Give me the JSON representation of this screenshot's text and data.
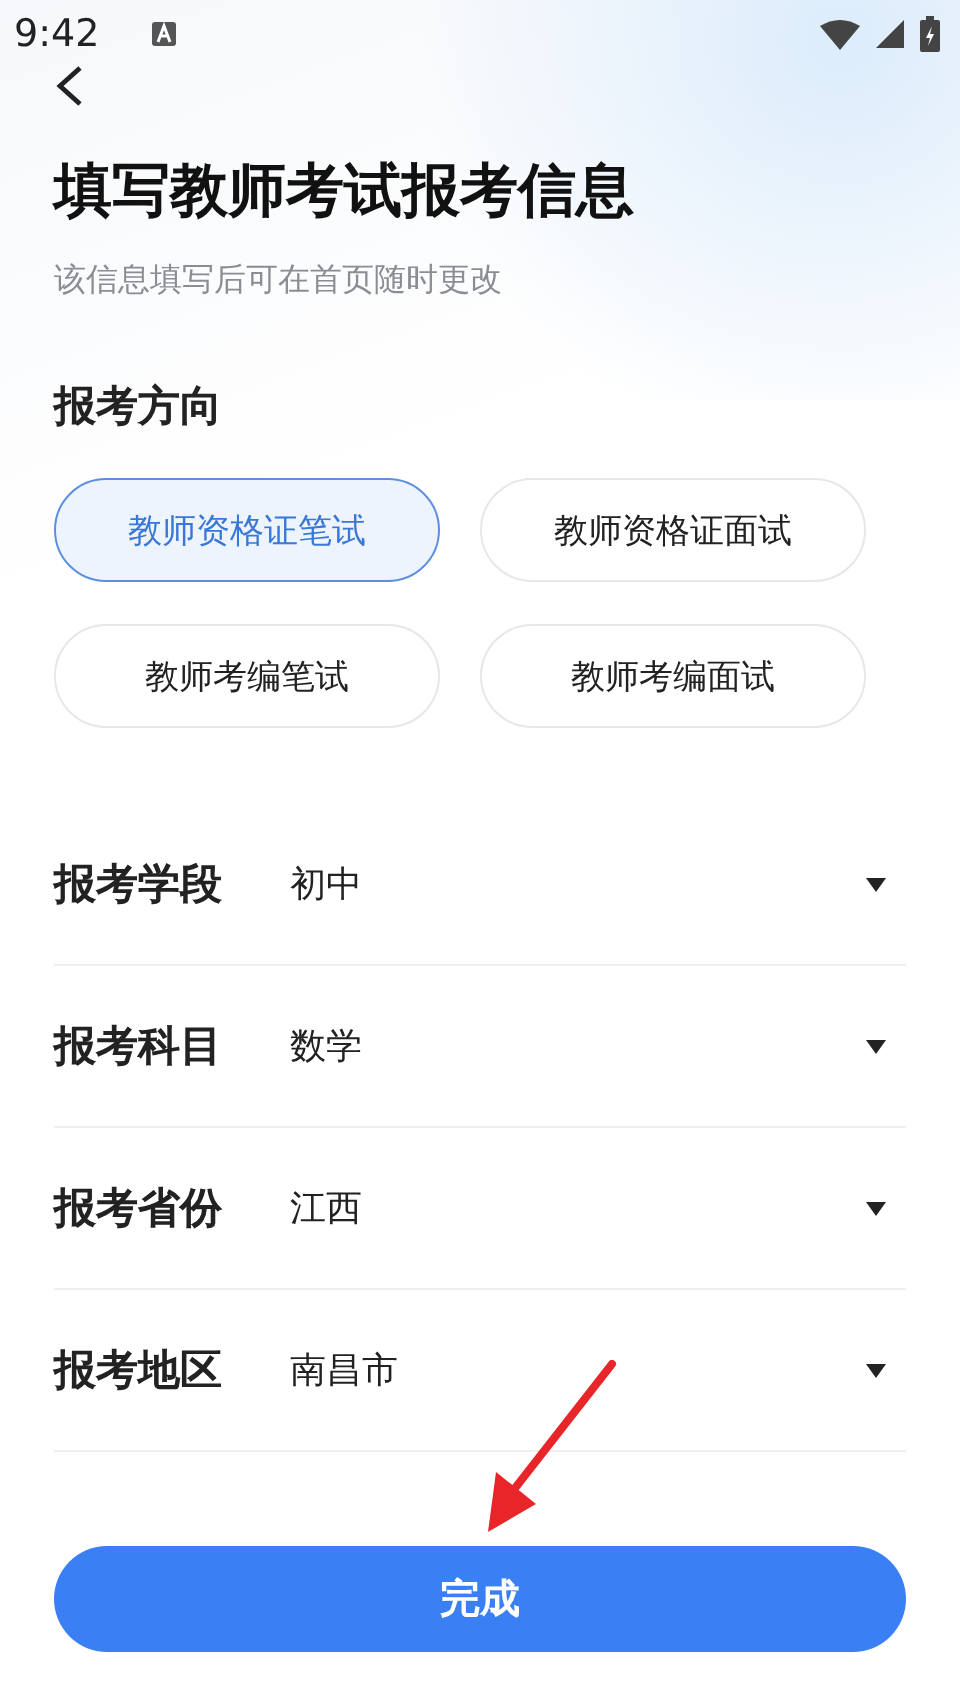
{
  "status_bar": {
    "time": "9:42"
  },
  "title": "填写教师考试报考信息",
  "subtitle": "该信息填写后可在首页随时更改",
  "direction": {
    "heading": "报考方向",
    "options": [
      {
        "label": "教师资格证笔试",
        "selected": true
      },
      {
        "label": "教师资格证面试",
        "selected": false
      },
      {
        "label": "教师考编笔试",
        "selected": false
      },
      {
        "label": "教师考编面试",
        "selected": false
      }
    ]
  },
  "fields": [
    {
      "label": "报考学段",
      "value": "初中"
    },
    {
      "label": "报考科目",
      "value": "数学"
    },
    {
      "label": "报考省份",
      "value": "江西"
    },
    {
      "label": "报考地区",
      "value": "南昌市"
    }
  ],
  "submit": "完成"
}
